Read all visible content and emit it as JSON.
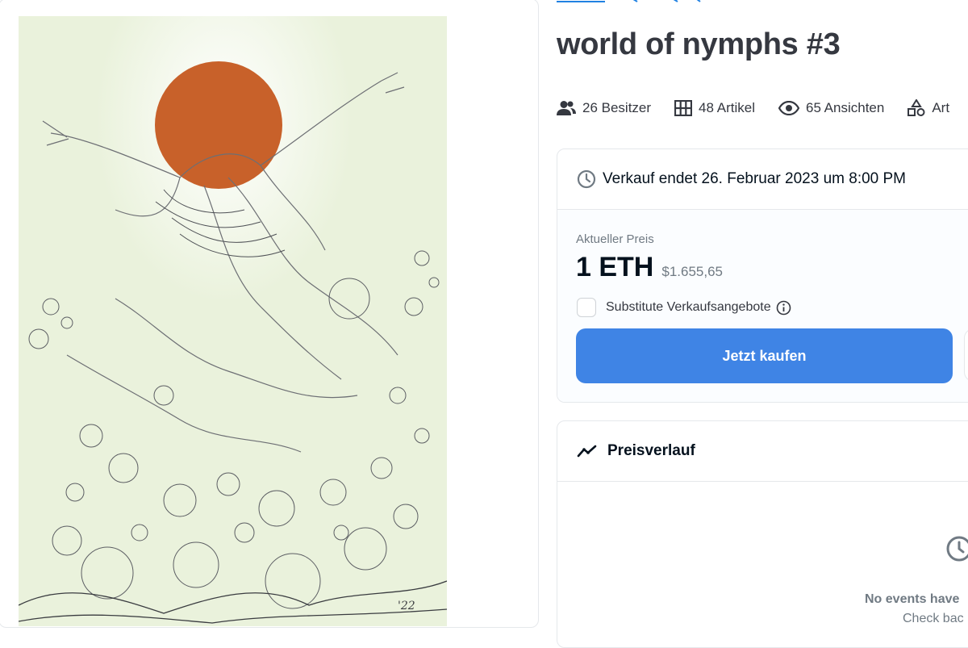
{
  "item": {
    "title": "world of nymphs #3",
    "stats": [
      {
        "icon": "owners-icon",
        "label": "26 Besitzer"
      },
      {
        "icon": "grid-icon",
        "label": "48 Artikel"
      },
      {
        "icon": "eye-icon",
        "label": "65 Ansichten"
      },
      {
        "icon": "category-shapes-icon",
        "label": "Art"
      }
    ]
  },
  "listing": {
    "sale_end": "Verkauf endet 26. Februar 2023 um 8:00 PM",
    "price_label": "Aktueller Preis",
    "price_eth": "1 ETH",
    "price_usd": "$1.655,65",
    "substitute_label": "Substitute Verkaufsangebote",
    "buy_label": "Jetzt kaufen"
  },
  "history": {
    "title": "Preisverlauf",
    "empty_title": "No events have",
    "empty_sub": "Check bac"
  },
  "colors": {
    "accent": "#3f84e5",
    "sun": "#c8612a",
    "paper": "#eef4e2"
  }
}
